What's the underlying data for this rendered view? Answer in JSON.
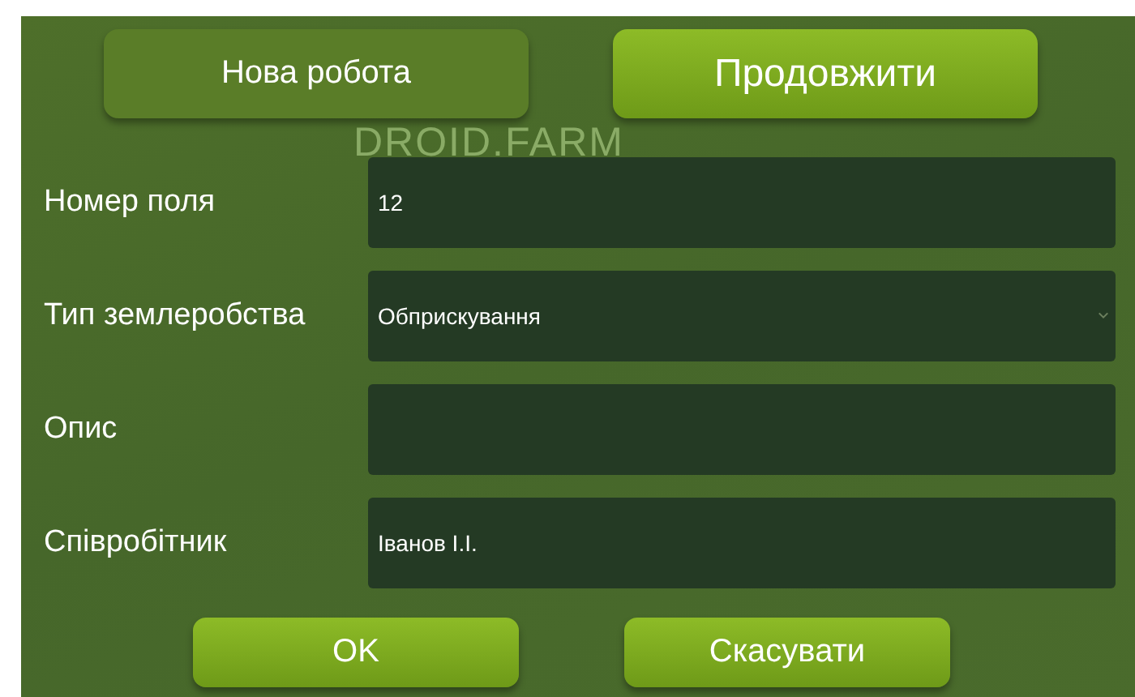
{
  "logo": "DROID.FARM",
  "top_buttons": [
    {
      "label": "Нова робота",
      "selected": false
    },
    {
      "label": "Продовжити",
      "selected": true
    }
  ],
  "fields": [
    {
      "label": "Номер поля",
      "kind": "text",
      "value": "12"
    },
    {
      "label": "Тип землеробства",
      "kind": "select",
      "value": "Обприскування"
    },
    {
      "label": "Опис",
      "kind": "text"
    },
    {
      "label": "Співробітник",
      "kind": "text",
      "value": "Іванов І.І."
    }
  ],
  "buttons": [
    "OK",
    "Скасувати"
  ]
}
